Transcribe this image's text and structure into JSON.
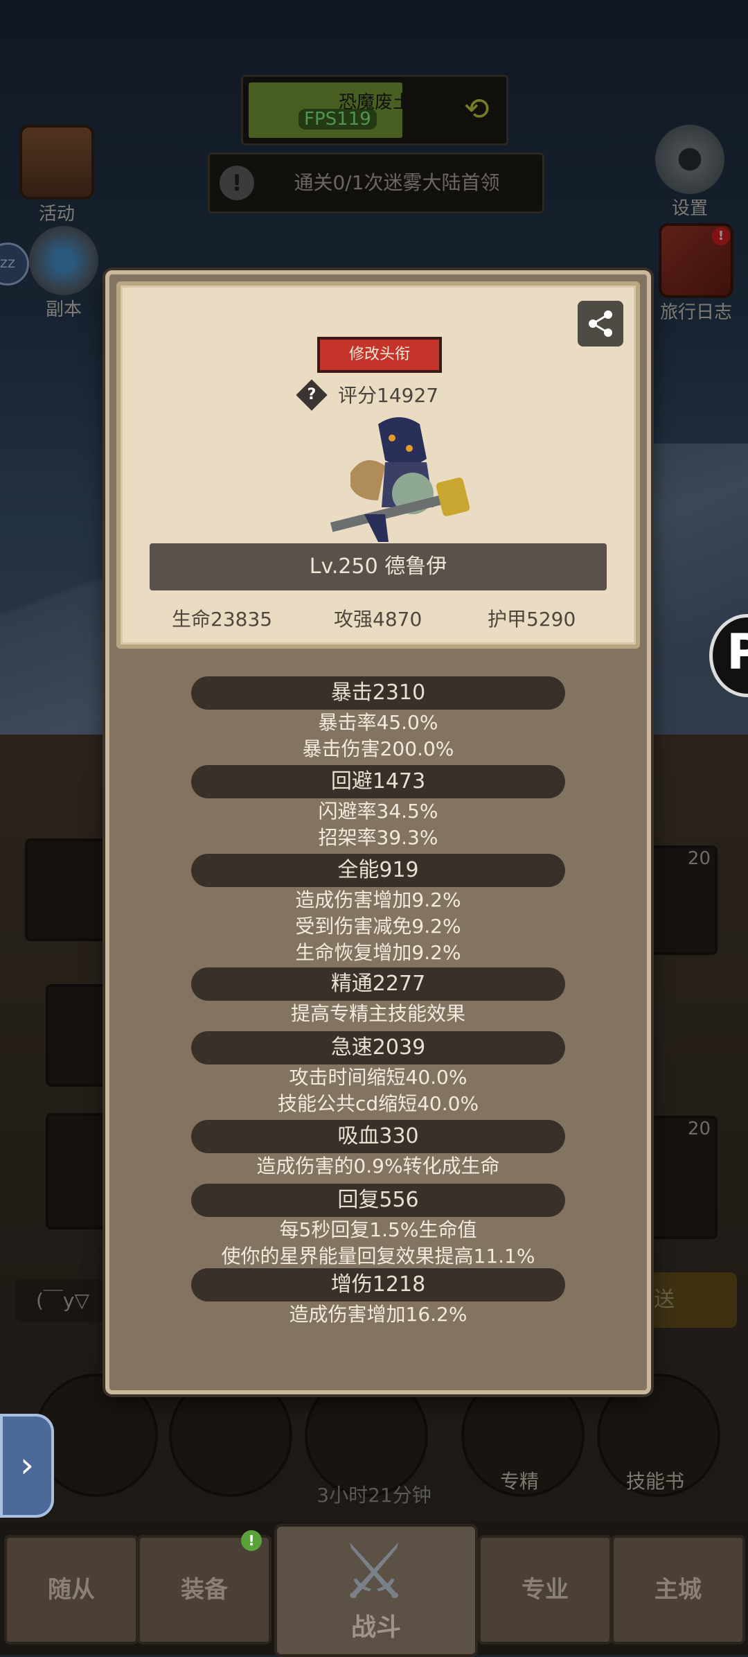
{
  "hud": {
    "boss_name": "恐魔废土",
    "fps": "FPS119",
    "boss_progress_peek": "0",
    "quest": "通关0/1次迷雾大陆首领"
  },
  "side": {
    "activity": "活动",
    "dungeon": "副本",
    "settings": "设置",
    "journal": "旅行日志",
    "zz": "ZZ"
  },
  "background_ui": {
    "chat_preview": "(￣y▽",
    "send": "发送",
    "timer": "3小时21分钟",
    "slot_levels": [
      "20",
      "20"
    ],
    "bottom_buttons": {
      "mastery": "专精",
      "skill_book": "技能书"
    }
  },
  "nav": {
    "follower": "随从",
    "equipment": "装备",
    "battle": "战斗",
    "profession": "专业",
    "main_city": "主城"
  },
  "profile": {
    "edit_title": "修改头衔",
    "score": "评分14927",
    "name": "Lv.250 德鲁伊",
    "hp": "生命23835",
    "attack": "攻强4870",
    "armor": "护甲5290"
  },
  "stat_groups": [
    {
      "header": "暴击2310",
      "lines": [
        "暴击率45.0%",
        "暴击伤害200.0%"
      ]
    },
    {
      "header": "回避1473",
      "lines": [
        "闪避率34.5%",
        "招架率39.3%"
      ]
    },
    {
      "header": "全能919",
      "lines": [
        "造成伤害增加9.2%",
        "受到伤害减免9.2%",
        "生命恢复增加9.2%"
      ]
    },
    {
      "header": "精通2277",
      "lines": [
        "提高专精主技能效果"
      ]
    },
    {
      "header": "急速2039",
      "lines": [
        "攻击时间缩短40.0%",
        "技能公共cd缩短40.0%"
      ]
    },
    {
      "header": "吸血330",
      "lines": [
        "造成伤害的0.9%转化成生命"
      ]
    },
    {
      "header": "回复556",
      "lines": [
        "每5秒回复1.5%生命值",
        "使你的星界能量回复效果提高11.1%"
      ]
    },
    {
      "header": "增伤1218",
      "lines": [
        "造成伤害增加16.2%"
      ]
    }
  ],
  "colors": {
    "edit_title_bg": "#c5342a",
    "modal_bg": "#837462",
    "card_bg": "#eadcc2",
    "fps_text": "#8aff8a"
  }
}
